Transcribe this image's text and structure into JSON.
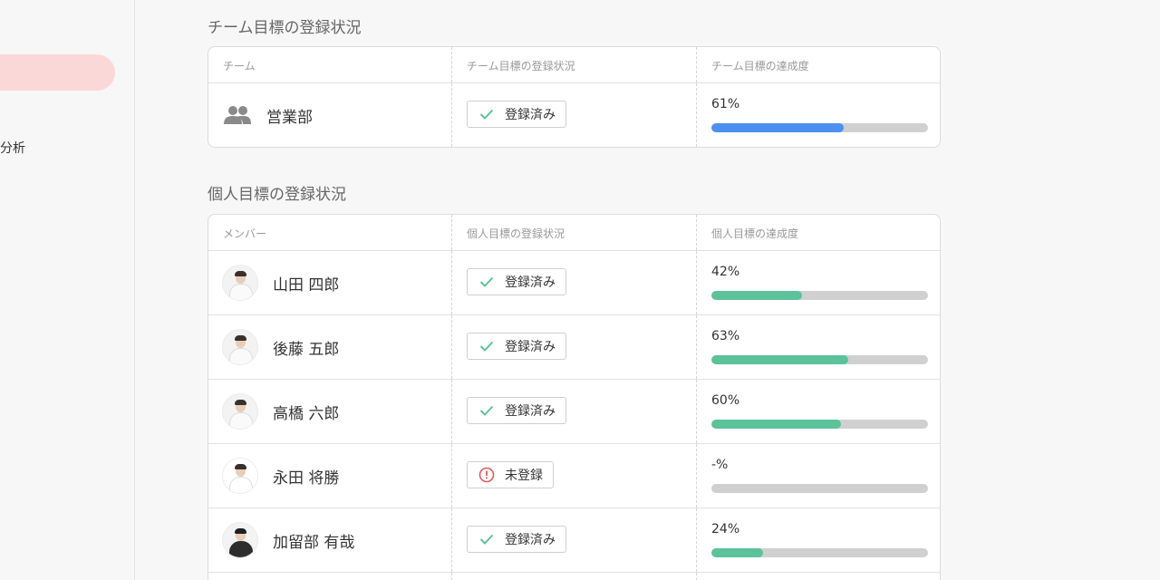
{
  "sidebar": {
    "partial_item": "分析"
  },
  "team_section": {
    "title": "チーム目標の登録状況",
    "headers": [
      "チーム",
      "チーム目標の登録状況",
      "チーム目標の達成度"
    ],
    "rows": [
      {
        "name": "営業部",
        "status": "登録済み",
        "status_type": "registered",
        "percent_label": "61%",
        "progress": 0.61
      }
    ]
  },
  "personal_section": {
    "title": "個人目標の登録状況",
    "headers": [
      "メンバー",
      "個人目標の登録状況",
      "個人目標の達成度"
    ],
    "rows": [
      {
        "name": "山田 四郎",
        "status": "登録済み",
        "status_type": "registered",
        "percent_label": "42%",
        "progress": 0.42
      },
      {
        "name": "後藤 五郎",
        "status": "登録済み",
        "status_type": "registered",
        "percent_label": "63%",
        "progress": 0.63
      },
      {
        "name": "高橋 六郎",
        "status": "登録済み",
        "status_type": "registered",
        "percent_label": "60%",
        "progress": 0.6
      },
      {
        "name": "永田 将勝",
        "status": "未登録",
        "status_type": "unregistered",
        "percent_label": "-%",
        "progress": 0
      },
      {
        "name": "加留部 有哉",
        "status": "登録済み",
        "status_type": "registered",
        "percent_label": "24%",
        "progress": 0.24
      }
    ]
  },
  "colors": {
    "team_bar": "#4d90f0",
    "personal_bar": "#5cc29a",
    "check": "#5cc29a",
    "alert": "#e25c5c",
    "active_nav": "#fbd8d8"
  },
  "icons": {
    "team": "group-icon",
    "registered": "check-icon",
    "unregistered": "alert-circle-icon"
  }
}
